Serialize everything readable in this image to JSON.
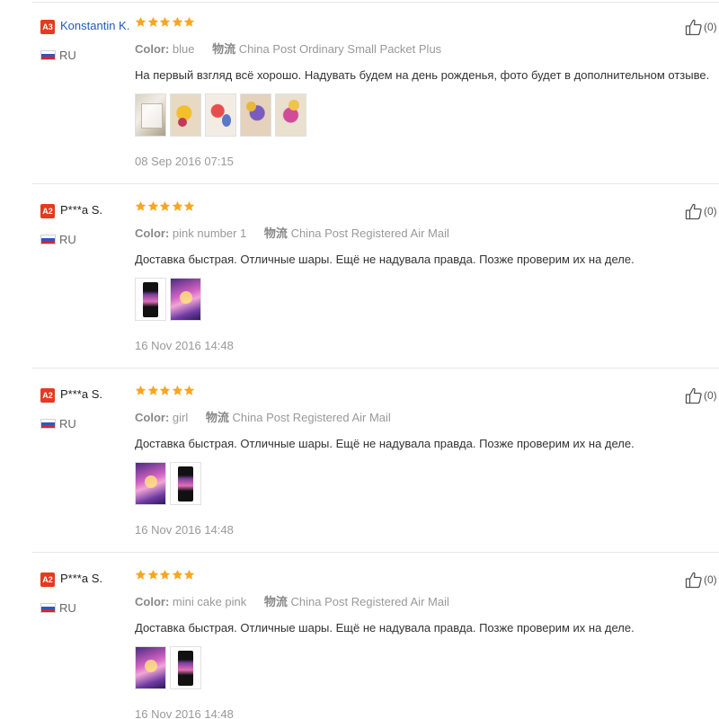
{
  "colors": {
    "badge_bg": "#e43a20",
    "star": "#f6a623",
    "link": "#1f5bb7",
    "divider": "#e6e6e6"
  },
  "labels": {
    "color_label": "Color:",
    "shipping_label": "物流"
  },
  "reviews": [
    {
      "badge": "A3",
      "user": "Konstantin K.",
      "user_is_link": true,
      "country": "RU",
      "rating": 5,
      "color": "blue",
      "shipping": "China Post Ordinary Small Packet Plus",
      "text": "На первый взгляд всё хорошо. Надувать будем на день рожденья, фото будет в дополнительном отзыве.",
      "photos": [
        "boxes",
        "balloons1",
        "balloons2",
        "balloons3",
        "balloons4"
      ],
      "date": "08 Sep 2016 07:15",
      "helpful_count": "(0)"
    },
    {
      "badge": "A2",
      "user": "P***a S.",
      "user_is_link": false,
      "country": "RU",
      "rating": 5,
      "color": "pink number 1",
      "shipping": "China Post Registered Air Mail",
      "text": "Доставка быстрая. Отличные шары. Ещё не надувала правда. Позже проверим их на деле.",
      "photos": [
        "phone",
        "pinkpack"
      ],
      "date": "16 Nov 2016 14:48",
      "helpful_count": "(0)"
    },
    {
      "badge": "A2",
      "user": "P***a S.",
      "user_is_link": false,
      "country": "RU",
      "rating": 5,
      "color": "girl",
      "shipping": "China Post Registered Air Mail",
      "text": "Доставка быстрая. Отличные шары. Ещё не надувала правда. Позже проверим их на деле.",
      "photos": [
        "pinkpack",
        "phone"
      ],
      "date": "16 Nov 2016 14:48",
      "helpful_count": "(0)"
    },
    {
      "badge": "A2",
      "user": "P***a S.",
      "user_is_link": false,
      "country": "RU",
      "rating": 5,
      "color": "mini cake pink",
      "shipping": "China Post Registered Air Mail",
      "text": "Доставка быстрая. Отличные шары. Ещё не надувала правда. Позже проверим их на деле.",
      "photos": [
        "pinkpack",
        "phone"
      ],
      "date": "16 Nov 2016 14:48",
      "helpful_count": "(0)"
    }
  ]
}
